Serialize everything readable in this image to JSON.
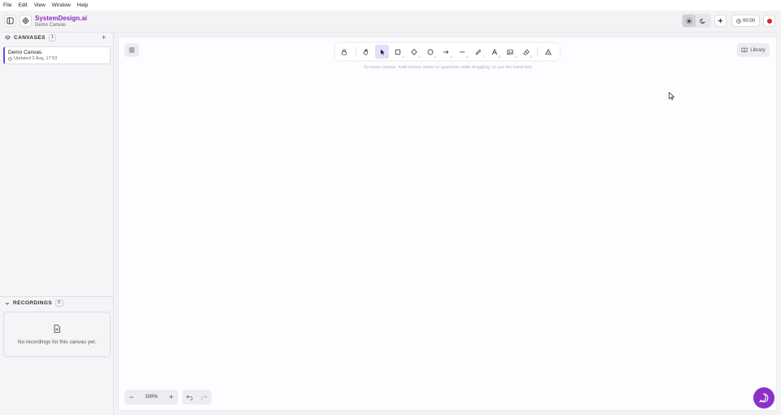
{
  "menubar": {
    "items": [
      "File",
      "Edit",
      "View",
      "Window",
      "Help"
    ]
  },
  "header": {
    "app_name": "SystemDesign.ai",
    "canvas_name": "Demo Canvas",
    "timer": "00:00",
    "theme_options": [
      "sun-icon",
      "moon-icon"
    ],
    "theme_selected": "light"
  },
  "sidebar": {
    "canvases_title": "CANVASES",
    "canvases_count": "1",
    "canvases": [
      {
        "name": "Demo Canvas",
        "updated": "Updated 2 Aug, 17:53",
        "selected": true
      }
    ],
    "recordings_title": "RECORDINGS",
    "recordings_count": "0",
    "recordings_empty": "No recordings for this canvas yet."
  },
  "toolbar": {
    "tools": [
      {
        "name": "lock",
        "key": ""
      },
      {
        "name": "hand",
        "key": ""
      },
      {
        "name": "selection",
        "key": "1",
        "active": true
      },
      {
        "name": "rectangle",
        "key": "2"
      },
      {
        "name": "diamond",
        "key": "3"
      },
      {
        "name": "ellipse",
        "key": "4"
      },
      {
        "name": "arrow",
        "key": "5"
      },
      {
        "name": "line",
        "key": "6"
      },
      {
        "name": "draw",
        "key": "7"
      },
      {
        "name": "text",
        "key": "8"
      },
      {
        "name": "image",
        "key": "9"
      },
      {
        "name": "eraser",
        "key": "0"
      },
      {
        "name": "more-tools",
        "key": ""
      }
    ],
    "hint": "To move canvas, hold mouse wheel or spacebar while dragging, or use the hand tool"
  },
  "library_label": "Library",
  "zoom": {
    "level": "100%"
  },
  "colors": {
    "brand": "#8a2bbf",
    "accent": "#6c4bd6",
    "record": "#e0202a",
    "chat": "#8a32c6"
  }
}
